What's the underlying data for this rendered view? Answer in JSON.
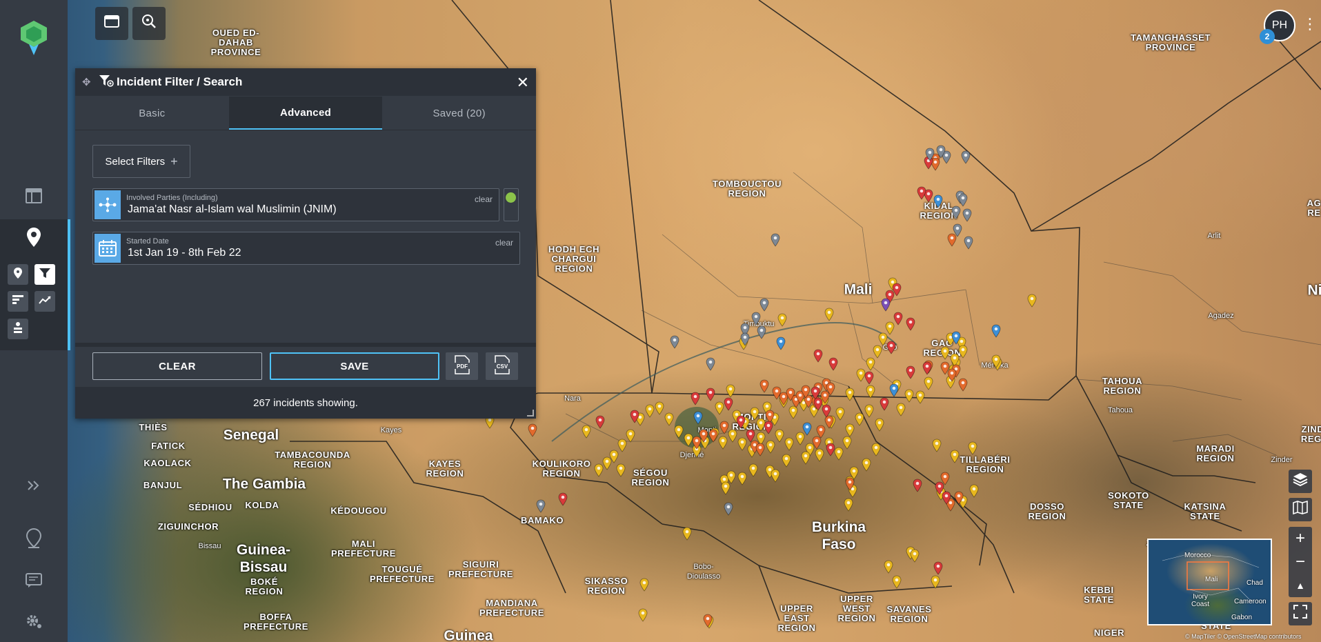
{
  "map": {
    "labels_region": [
      {
        "text": "OUED ED-\nDAHAB\nPROVINCE"
      },
      {
        "text": "TAMANGHASSET\nPROVINCE"
      },
      {
        "text": "TOMBOUCTOU\nREGION"
      },
      {
        "text": "HODH ECH\nCHARGUI\nREGION"
      },
      {
        "text": "KIDAL\nREGION"
      },
      {
        "text": "GAO\nREGION"
      },
      {
        "text": "MOPTI\nREGION"
      },
      {
        "text": "TAHOUA\nREGION"
      },
      {
        "text": "KOULIKORO\nREGION"
      },
      {
        "text": "SÉGOU\nREGION"
      },
      {
        "text": "KAYES\nREGION"
      },
      {
        "text": "TAMBACOUNDA\nREGION"
      },
      {
        "text": "KAOLACK"
      },
      {
        "text": "FATICK"
      },
      {
        "text": "THIÈS"
      },
      {
        "text": "BANJUL"
      },
      {
        "text": "SÉDHIOU"
      },
      {
        "text": "KOLDA"
      },
      {
        "text": "ZIGUINCHOR"
      },
      {
        "text": "KÉDOUGOU"
      },
      {
        "text": "BAMAKO"
      },
      {
        "text": "TILLABÉRI\nREGION"
      },
      {
        "text": "MARADI\nREGION"
      },
      {
        "text": "ZIND\nREGI"
      },
      {
        "text": "DOSSO\nREGION"
      },
      {
        "text": "SOKOTO\nSTATE"
      },
      {
        "text": "KATSINA\nSTATE"
      },
      {
        "text": "KEBBI\nSTATE"
      },
      {
        "text": "NIGER"
      },
      {
        "text": "MALI\nPREFECTURE"
      },
      {
        "text": "TOUGUÉ\nPREFECTURE"
      },
      {
        "text": "SIGUIRI\nPREFECTURE"
      },
      {
        "text": "SIKASSO\nREGION"
      },
      {
        "text": "MANDIANA\nPREFECTURE"
      },
      {
        "text": "BOKÉ\nREGION"
      },
      {
        "text": "BOFFA\nPREFECTURE"
      },
      {
        "text": "UPPER\nEAST\nREGION"
      },
      {
        "text": "UPPER\nWEST\nREGION"
      },
      {
        "text": "SAVANES\nREGION"
      },
      {
        "text": "AG\nRE"
      },
      {
        "text": "STATE"
      }
    ],
    "labels_country": [
      {
        "text": "Mali"
      },
      {
        "text": "Senegal"
      },
      {
        "text": "The Gambia"
      },
      {
        "text": "Guinea-\nBissau"
      },
      {
        "text": "Burkina\nFaso"
      },
      {
        "text": "Guinea"
      },
      {
        "text": "Ni"
      }
    ],
    "labels_city": [
      {
        "text": "Arlit"
      },
      {
        "text": "Agadez"
      },
      {
        "text": "Tahoua"
      },
      {
        "text": "Nara"
      },
      {
        "text": "Kayes"
      },
      {
        "text": "Timbuktu"
      },
      {
        "text": "Gao"
      },
      {
        "text": "Ménaka"
      },
      {
        "text": "Mopti"
      },
      {
        "text": "Djenné"
      },
      {
        "text": "Bissau"
      },
      {
        "text": "Bobo-\nDioulasso"
      },
      {
        "text": "Zinder"
      },
      {
        "text": "Za"
      }
    ],
    "marker_colors": {
      "yellow": "#e8b71e",
      "orange": "#e26a2c",
      "red": "#d83a3a",
      "grey": "#7d8894",
      "blue": "#3d8fd6",
      "purple": "#7b4fb5"
    },
    "attribution": "© MapTiler © OpenStreetMap contributors"
  },
  "top_buttons": {
    "layer_icon": "panel-icon",
    "search_icon": "map-search-icon"
  },
  "sidebar": {
    "icons": [
      "logo-icon",
      "table-icon",
      "incident-pin-icon",
      "location-icon",
      "filter-icon",
      "bar-list-icon",
      "trend-icon",
      "stack-icon",
      "expand-icon",
      "add-location-icon",
      "report-icon",
      "settings-icon"
    ]
  },
  "panel": {
    "title": "Incident Filter / Search",
    "tabs": [
      {
        "label": "Basic"
      },
      {
        "label": "Advanced"
      },
      {
        "label": "Saved (20)"
      }
    ],
    "select_filters": "Select Filters",
    "filters": [
      {
        "label": "Involved Parties (Including)",
        "value": "Jama'at Nasr al-Islam wal Muslimin (JNIM)",
        "clear": "clear"
      },
      {
        "label": "Started Date",
        "value": "1st Jan 19 - 8th Feb 22",
        "clear": "clear"
      }
    ],
    "clear_button": "CLEAR",
    "save_button": "SAVE",
    "export_pdf": "PDF",
    "export_csv": "CSV",
    "status": "267 incidents showing."
  },
  "user": {
    "initials": "PH",
    "notifications": "2"
  },
  "minimap": {
    "labels": [
      "Morocco",
      "Mali",
      "Chad",
      "Ivory\nCoast",
      "Cameroon",
      "Gabon"
    ]
  }
}
